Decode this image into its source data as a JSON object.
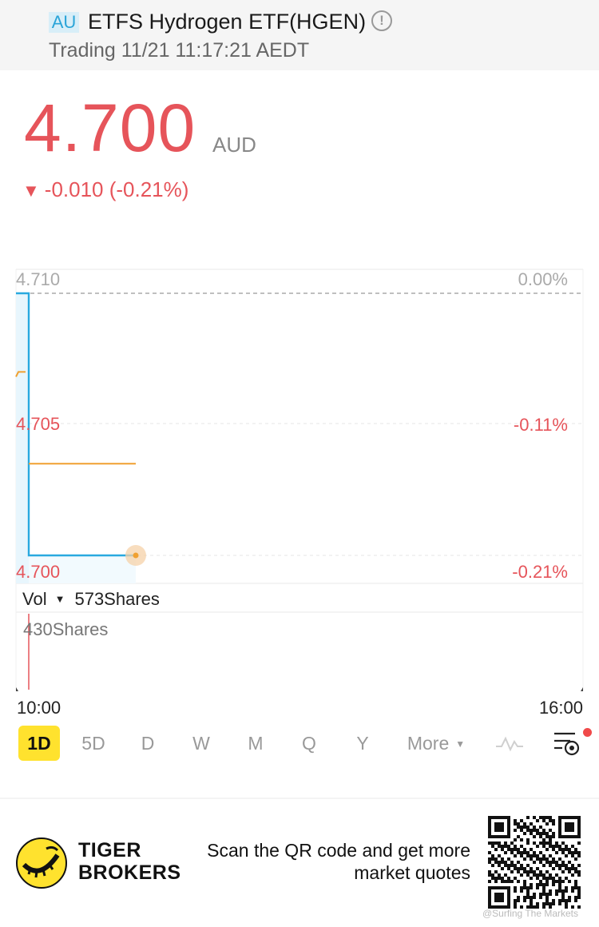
{
  "header": {
    "market_tag": "AU",
    "title": "ETFS Hydrogen ETF(HGEN)",
    "status": "Trading 11/21 11:17:21 AEDT"
  },
  "quote": {
    "price": "4.700",
    "currency": "AUD",
    "change_arrow": "▼",
    "change": "-0.010 (-0.21%)"
  },
  "chart_data": {
    "type": "line",
    "title": "",
    "x": [
      "10:00",
      "10:01",
      "10:02"
    ],
    "series": [
      {
        "values": [
          4.71,
          4.7,
          4.7
        ],
        "color": "#29a9df"
      },
      {
        "values": [
          4.707,
          4.7035,
          4.7035
        ],
        "color": "#f0a030"
      }
    ],
    "ylim": [
      4.7,
      4.71
    ],
    "y_ticks_left": [
      "4.710",
      "4.705",
      "4.700"
    ],
    "y_ticks_right": [
      "0.00%",
      "-0.11%",
      "-0.21%"
    ],
    "x_ticks": [
      "10:00",
      "16:00"
    ],
    "prev_close": 4.71,
    "colors": {
      "up": "#e6545a",
      "price_line": "#29a9df",
      "avg_line": "#f0a030"
    }
  },
  "volume": {
    "label": "Vol",
    "current": "573Shares",
    "max_label": "430Shares"
  },
  "periods": {
    "items": [
      "1D",
      "5D",
      "D",
      "W",
      "M",
      "Q",
      "Y"
    ],
    "more": "More",
    "active": "1D"
  },
  "icons": {
    "info": "info-icon",
    "indicator": "indicator-wave-icon",
    "settings": "chart-settings-icon",
    "logo": "tiger-logo-icon",
    "qr": "qr-code-icon"
  },
  "footer": {
    "brand_line1": "TIGER",
    "brand_line2": "BROKERS",
    "scan_text": "Scan the QR code and get more market quotes",
    "watermark": "@Surfing The Markets"
  }
}
